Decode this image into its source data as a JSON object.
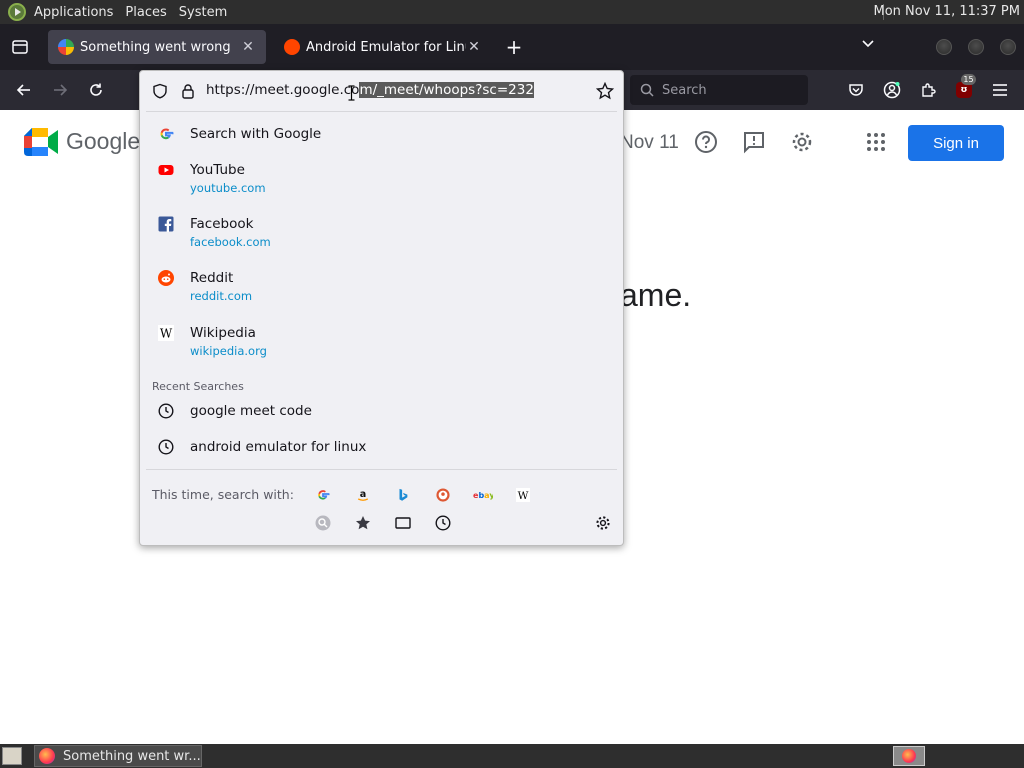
{
  "top_panel": {
    "menus": [
      "Applications",
      "Places",
      "System"
    ],
    "clock": "Mon Nov 11, 11:37 PM"
  },
  "tabs": [
    {
      "title": "Something went wrong",
      "active": true,
      "icon": "google-meet-icon"
    },
    {
      "title": "Android Emulator for Linux",
      "active": false,
      "icon": "reddit-icon"
    }
  ],
  "nav": {
    "url": "https://meet.google.com/_meet/whoops?sc=232",
    "url_unselected": "https://meet.google.co",
    "url_selected": "m/_meet/whoops?sc=232",
    "search_placeholder": "Search",
    "ublock_badge": "15"
  },
  "page": {
    "logo_text": "Google",
    "date_fragment": "Nov 11",
    "sign_in": "Sign in",
    "heading_fragment": "ame.",
    "brand_color": "#1a73e8"
  },
  "dropdown": {
    "search_with": "Search with Google",
    "top_sites": [
      {
        "title": "YouTube",
        "url": "youtube.com",
        "icon": "youtube-icon"
      },
      {
        "title": "Facebook",
        "url": "facebook.com",
        "icon": "facebook-icon"
      },
      {
        "title": "Reddit",
        "url": "reddit.com",
        "icon": "reddit-icon"
      },
      {
        "title": "Wikipedia",
        "url": "wikipedia.org",
        "icon": "wikipedia-icon"
      }
    ],
    "recent_header": "Recent Searches",
    "recent": [
      "google meet code",
      "android emulator for linux"
    ],
    "oneoff_label": "This time, search with:",
    "engines": [
      "google-icon",
      "amazon-icon",
      "bing-icon",
      "duckduckgo-icon",
      "ebay-icon",
      "wikipedia-icon"
    ],
    "modes": [
      "search-icon",
      "bookmarks-icon",
      "tabs-icon",
      "history-icon"
    ]
  },
  "taskbar": {
    "window_title": "Something went wr..."
  }
}
